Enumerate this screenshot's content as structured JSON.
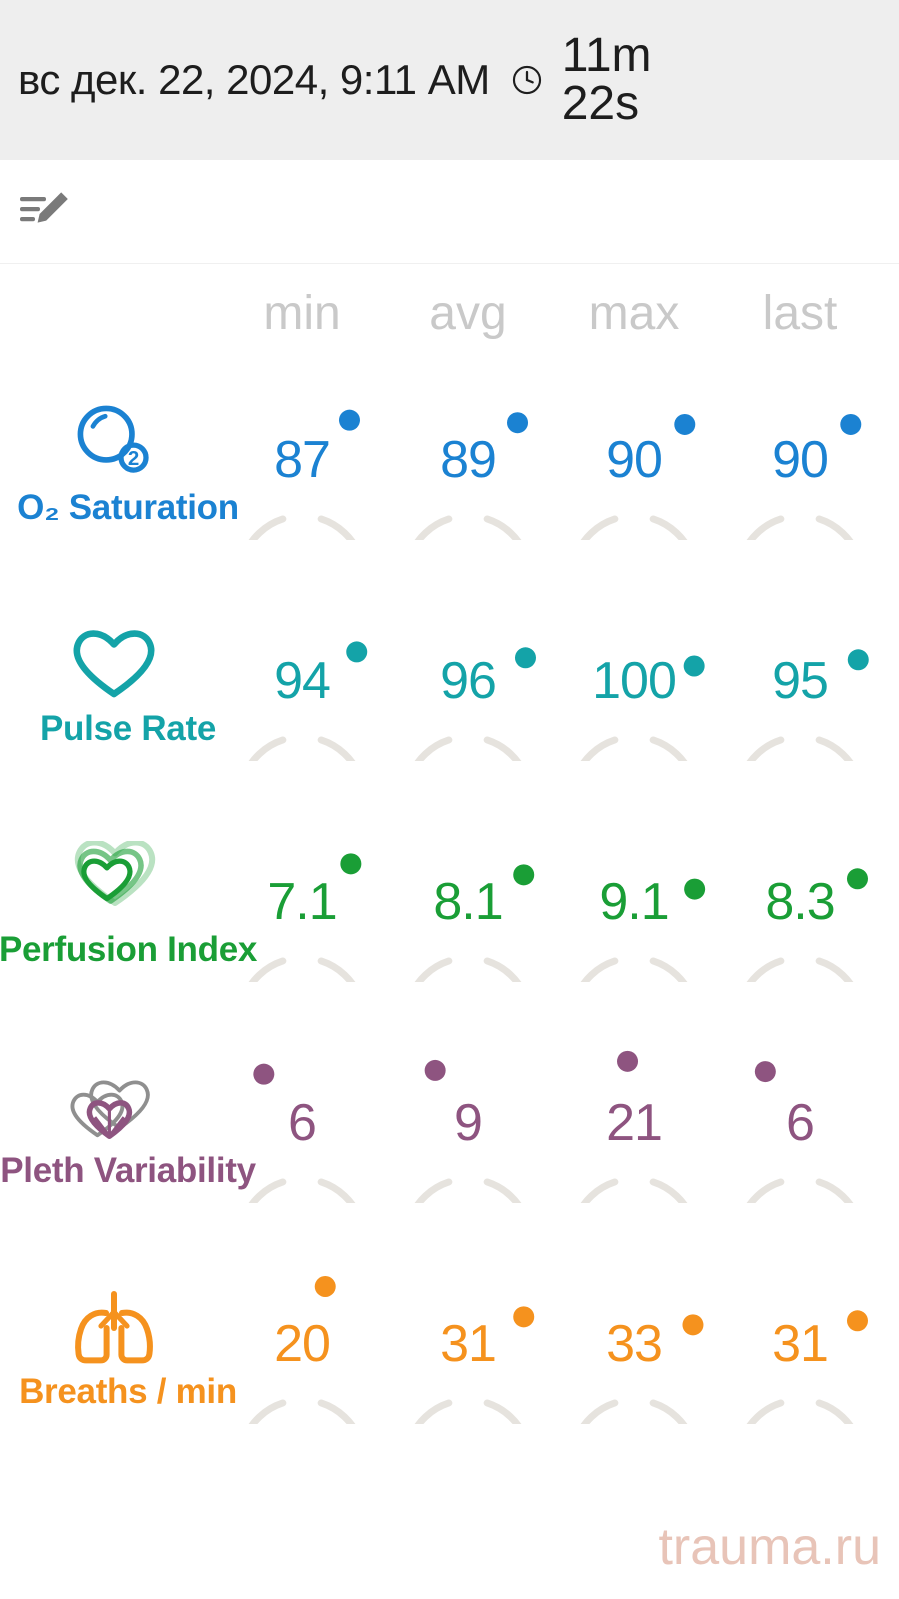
{
  "header": {
    "datetime": "вс дек. 22, 2024, 9:11 AM",
    "clock_icon": "clock-icon",
    "duration": "11m\n22s",
    "background": "#eeeeee"
  },
  "note": {
    "edit_icon": "note-edit-icon"
  },
  "columns": [
    "min",
    "avg",
    "max",
    "last"
  ],
  "watermark": "trauma.ru",
  "chart_data": {
    "type": "table",
    "title": "",
    "columns": [
      "min",
      "avg",
      "max",
      "last"
    ],
    "rows": [
      {
        "label": "O₂ Saturation",
        "icon": "oxygen-molecule-icon",
        "color": "#1b82d2",
        "values": [
          "87",
          "89",
          "90",
          "90"
        ],
        "numeric": [
          87,
          89,
          90,
          90
        ],
        "range": [
          0,
          100
        ],
        "marker_angles": [
          320,
          323,
          325,
          325
        ]
      },
      {
        "label": "Pulse Rate",
        "icon": "heart-outline-icon",
        "color": "#14a3a8",
        "values": [
          "94",
          "96",
          "100",
          "95"
        ],
        "numeric": [
          94,
          96,
          100,
          95
        ],
        "range": [
          0,
          250
        ],
        "marker_angles": [
          -28,
          -22,
          -14,
          -20
        ]
      },
      {
        "label": "Perfusion Index",
        "icon": "triple-heart-icon",
        "color": "#1a9e36",
        "values": [
          "7.1",
          "8.1",
          "9.1",
          "8.3"
        ],
        "numeric": [
          7.1,
          8.1,
          9.1,
          8.3
        ],
        "range": [
          0,
          20
        ],
        "marker_angles": [
          -38,
          -26,
          -12,
          -22
        ]
      },
      {
        "label": "Pleth Variability",
        "icon": "double-heart-icon",
        "color": "#8e5480",
        "values": [
          "6",
          "9",
          "21",
          "6"
        ],
        "numeric": [
          6,
          9,
          21,
          6
        ],
        "range": [
          0,
          100
        ],
        "marker_angles": [
          -128,
          -122,
          -96,
          -124
        ]
      },
      {
        "label": "Breaths / min",
        "icon": "lungs-icon",
        "color": "#f5921e",
        "values": [
          "20",
          "31",
          "33",
          "31"
        ],
        "numeric": [
          20,
          31,
          33,
          31
        ],
        "range": [
          0,
          60
        ],
        "marker_angles": [
          -68,
          -26,
          -18,
          -22
        ]
      }
    ],
    "track_color": "#e6e3de",
    "header_color": "#c9c9c9"
  }
}
